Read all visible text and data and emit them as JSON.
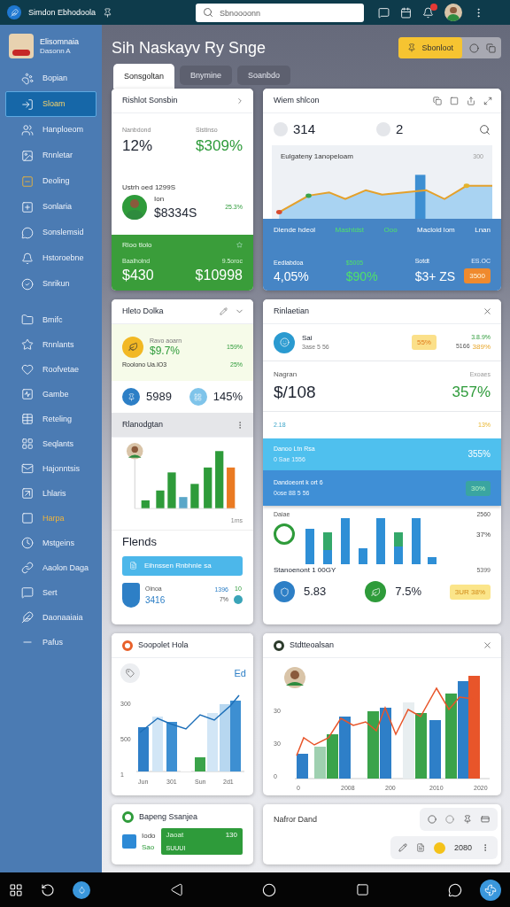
{
  "topbar": {
    "app_name": "Simdon Ebhodoola",
    "search": {
      "placeholder": "Sbnoooonn"
    }
  },
  "sidebar": {
    "profile": {
      "name": "Elisomnaia",
      "subtitle": "Dasonn A"
    },
    "items": [
      {
        "label": "Bopian",
        "selected": false,
        "highlighted": false
      },
      {
        "label": "Sloam",
        "selected": true,
        "highlighted": false
      },
      {
        "label": "Hanploeom",
        "selected": false,
        "highlighted": false
      },
      {
        "label": "Rnnletar",
        "selected": false,
        "highlighted": false
      },
      {
        "label": "Deoling",
        "selected": false,
        "highlighted": false
      },
      {
        "label": "Sonlaria",
        "selected": false,
        "highlighted": false
      },
      {
        "label": "Sonslemsid",
        "selected": false,
        "highlighted": false
      },
      {
        "label": "Hstoroebne",
        "selected": false,
        "highlighted": false
      },
      {
        "label": "Snrikun",
        "selected": false,
        "highlighted": false
      }
    ],
    "items_2": [
      {
        "label": "Bmifc",
        "selected": false,
        "highlighted": false
      },
      {
        "label": "Rnnlants",
        "selected": false,
        "highlighted": false
      },
      {
        "label": "Roofvetae",
        "selected": false,
        "highlighted": false
      },
      {
        "label": "Gambe",
        "selected": false,
        "highlighted": false
      },
      {
        "label": "Reteling",
        "selected": false,
        "highlighted": false
      },
      {
        "label": "Seqlants",
        "selected": false,
        "highlighted": false
      },
      {
        "label": "Hajonntsis",
        "selected": false,
        "highlighted": false
      },
      {
        "label": "Lhlaris",
        "selected": false,
        "highlighted": false
      },
      {
        "label": "Harpa",
        "selected": false,
        "highlighted": true
      },
      {
        "label": "Mstgeins",
        "selected": false,
        "highlighted": false
      },
      {
        "label": "Aaolon Daga",
        "selected": false,
        "highlighted": false
      },
      {
        "label": "Sert",
        "selected": false,
        "highlighted": false
      },
      {
        "label": "Daonaaiaia",
        "selected": false,
        "highlighted": false
      },
      {
        "label": "Pafus",
        "selected": false,
        "highlighted": false
      }
    ]
  },
  "page": {
    "title": "Sih Naskayv Ry Snge",
    "action": "Sbonloot",
    "tabs": [
      {
        "label": "Sonsgoltan",
        "selected": true
      },
      {
        "label": "Bnymine",
        "selected": false
      },
      {
        "label": "Soanbdo",
        "selected": false
      }
    ]
  },
  "summary_card": {
    "title": "Rishlot Sonsbin",
    "stats": [
      {
        "label": "Nanbdond",
        "value": "12%",
        "green": false
      },
      {
        "label": "Sistinso",
        "value": "$309%",
        "green": true
      }
    ],
    "section": "Ustrh oed 1299S",
    "person": {
      "name": "Ion",
      "value": "$8334S",
      "change": "25.3%"
    },
    "footer": {
      "title": "Rloo tlolo",
      "stats": [
        {
          "label": "Baalholnd",
          "value": "$430"
        },
        {
          "label": "9.5oroc",
          "value": "$10998"
        }
      ]
    }
  },
  "trend_card": {
    "title": "Wiem shlcon",
    "counters": [
      "314",
      "2"
    ],
    "chart_title": "Eulgateny 1anopeloam",
    "chart_corner": "300",
    "heads": [
      {
        "label": "Dlende hdeol",
        "green": false
      },
      {
        "label": "Mashtdst",
        "green": true
      },
      {
        "label": "Ooo",
        "green": true
      },
      {
        "label": "Macloid lom",
        "green": false
      },
      {
        "label": "Lnan",
        "green": false
      }
    ],
    "metrics": [
      {
        "label": "Eedlabdoa",
        "value": "4,05%",
        "green": false
      },
      {
        "label": "$5005",
        "value": "$90%",
        "green": true
      },
      {
        "label": "Sotdt",
        "value": "$3+ ZS",
        "green": false
      }
    ],
    "metric_note": "ES.OC",
    "metric_badge": "3500"
  },
  "activity_card": {
    "title": "Hleto Dolka",
    "lead": {
      "label": "Ravo aoarn",
      "value": "$9.7%",
      "change": "159%"
    },
    "section": "Roolono Ua.IO3",
    "section_change": "25%",
    "counts": [
      "5989",
      "145%"
    ],
    "chart_title": "Rlanodgtan",
    "chart_label": "1ms",
    "list_title": "Flends",
    "button": "Eihnssen Rnbhnle sa",
    "entry": {
      "name": "Oinoa",
      "value": "3416",
      "stat_1": "1396",
      "stat_2": "7%",
      "stat_3": "10"
    }
  },
  "relation_card": {
    "title": "Rinlaetian",
    "lead": {
      "name": "Sai",
      "subtitle": "3ase 5 56",
      "badge": "55%",
      "change": "3.8.9%",
      "sub_value": "5166",
      "sub_change": "389%"
    },
    "big": {
      "label": "Nagran",
      "value": "$/108",
      "note": "Exoaes",
      "change": "357%"
    },
    "mini": {
      "label": "2.18",
      "value": "13%"
    },
    "rows": [
      {
        "title": "Danoo Ltn Rsa",
        "subtitle": "0 Sae 1556",
        "value": "355%",
        "selected": false
      },
      {
        "title": "Dandoeont k ort 6",
        "subtitle": "0ose 88 5 56",
        "value": "30%",
        "selected": true
      }
    ],
    "chart_label": "Daiae",
    "chart_corner": "2560",
    "chart_side": "37%",
    "stat_title": "Stanoenont 1 00GY",
    "stat_corner": "5399",
    "stat_1": "5.83",
    "stat_2": "7.5%",
    "badge": "3UR 38%"
  },
  "growth_card": {
    "title": "Soopolet Hola",
    "corner": "Ed",
    "yticks": [
      "300",
      "500",
      "1"
    ],
    "xlabels": [
      "Jun",
      "301",
      "Sun",
      "2d1"
    ]
  },
  "history_card": {
    "title": "Stdtteoalsan",
    "yticks": [
      "30",
      "30",
      "0"
    ],
    "xlabels": [
      "0",
      "2008",
      "200",
      "2010",
      "2020"
    ]
  },
  "savings_card": {
    "title": "Bapeng Ssanjea",
    "label_1": "Iodo",
    "label_2": "Sao",
    "bar_label": "Jaoat",
    "bar_value": "130",
    "bar_text": "SUUUI"
  },
  "notes_card": {
    "title": "Nafror Dand",
    "amount": "2080"
  }
}
